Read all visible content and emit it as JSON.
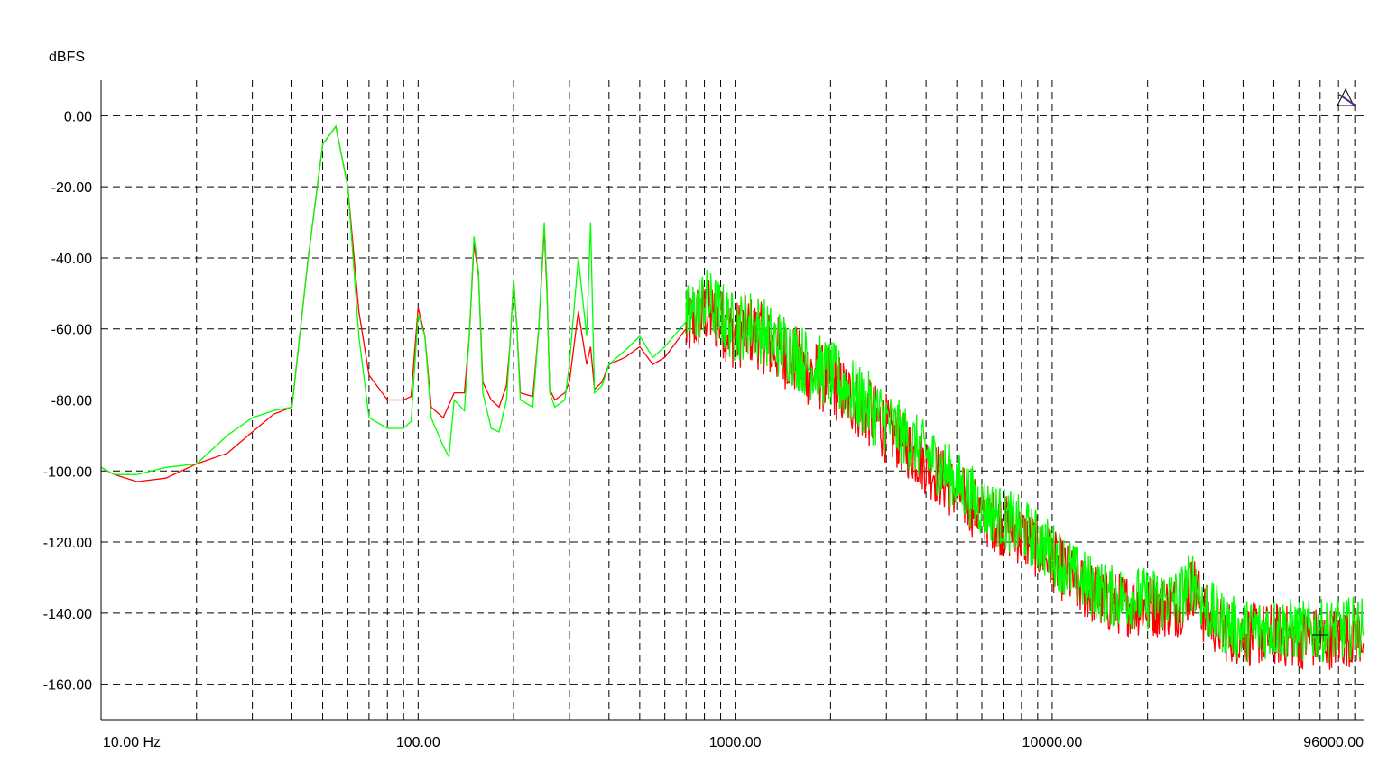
{
  "chart_data": {
    "type": "line",
    "title": "",
    "ylabel": "dBFS",
    "xlabel": "",
    "x_scale": "log",
    "xlim": [
      10,
      96000
    ],
    "ylim": [
      -170,
      10
    ],
    "grid": true,
    "x_tick_labels": [
      {
        "value": 10,
        "label": "10.00 Hz"
      },
      {
        "value": 100,
        "label": "100.00"
      },
      {
        "value": 1000,
        "label": "1000.00"
      },
      {
        "value": 10000,
        "label": "10000.00"
      },
      {
        "value": 96000,
        "label": "96000.00"
      }
    ],
    "y_tick_labels": [
      {
        "value": 0,
        "label": "0.00"
      },
      {
        "value": -20,
        "label": "-20.00"
      },
      {
        "value": -40,
        "label": "-40.00"
      },
      {
        "value": -60,
        "label": "-60.00"
      },
      {
        "value": -80,
        "label": "-80.00"
      },
      {
        "value": -100,
        "label": "-100.00"
      },
      {
        "value": -120,
        "label": "-120.00"
      },
      {
        "value": -140,
        "label": "-140.00"
      },
      {
        "value": -160,
        "label": "-160.00"
      }
    ],
    "series": [
      {
        "color": "#ff0000",
        "x": [
          10,
          11,
          13,
          16,
          20,
          25,
          30,
          35,
          40,
          45,
          50,
          55,
          60,
          65,
          70,
          80,
          90,
          95,
          100,
          105,
          110,
          120,
          130,
          140,
          145,
          150,
          155,
          160,
          170,
          180,
          190,
          195,
          200,
          205,
          210,
          230,
          240,
          250,
          255,
          260,
          270,
          290,
          300,
          320,
          340,
          350,
          360,
          380,
          400,
          450,
          500,
          550,
          600,
          700,
          800,
          900,
          1000,
          1100,
          1200,
          1300,
          1500,
          1700,
          2000,
          2500,
          3000,
          4000,
          5000,
          6000,
          8000,
          10000,
          12000,
          15000,
          20000,
          25000,
          28000,
          30000,
          35000,
          40000,
          50000,
          60000,
          80000,
          90000,
          96000
        ],
        "values": [
          -99,
          -101,
          -103,
          -102,
          -98,
          -95,
          -89,
          -84,
          -82,
          -40,
          -8,
          -3,
          -20,
          -55,
          -73,
          -80,
          -80,
          -79,
          -54,
          -62,
          -82,
          -85,
          -78,
          -78,
          -62,
          -36,
          -45,
          -75,
          -80,
          -82,
          -76,
          -64,
          -46,
          -60,
          -78,
          -79,
          -60,
          -32,
          -50,
          -77,
          -80,
          -78,
          -75,
          -55,
          -70,
          -65,
          -77,
          -75,
          -70,
          -68,
          -65,
          -70,
          -68,
          -60,
          -55,
          -58,
          -62,
          -60,
          -62,
          -65,
          -68,
          -72,
          -75,
          -82,
          -88,
          -98,
          -106,
          -112,
          -118,
          -125,
          -132,
          -137,
          -138,
          -138,
          -132,
          -140,
          -145,
          -146,
          -146,
          -147,
          -147,
          -146,
          -146
        ]
      },
      {
        "color": "#00ff00",
        "x": [
          10,
          11,
          13,
          16,
          20,
          25,
          30,
          35,
          40,
          45,
          50,
          55,
          60,
          65,
          70,
          80,
          90,
          95,
          100,
          105,
          110,
          120,
          125,
          130,
          140,
          145,
          150,
          155,
          160,
          170,
          180,
          190,
          195,
          200,
          205,
          210,
          230,
          240,
          250,
          255,
          260,
          270,
          290,
          300,
          320,
          340,
          350,
          360,
          380,
          400,
          450,
          500,
          550,
          600,
          700,
          800,
          900,
          1000,
          1100,
          1200,
          1300,
          1500,
          1700,
          2000,
          2500,
          3000,
          4000,
          5000,
          6000,
          8000,
          10000,
          12000,
          15000,
          20000,
          25000,
          28000,
          30000,
          35000,
          40000,
          50000,
          60000,
          80000,
          90000,
          96000
        ],
        "values": [
          -99,
          -101,
          -101,
          -99,
          -98,
          -90,
          -85,
          -83,
          -82,
          -40,
          -8,
          -3,
          -20,
          -62,
          -85,
          -88,
          -88,
          -86,
          -56,
          -62,
          -85,
          -93,
          -96,
          -80,
          -83,
          -62,
          -34,
          -44,
          -78,
          -88,
          -89,
          -80,
          -64,
          -46,
          -60,
          -80,
          -82,
          -60,
          -30,
          -48,
          -78,
          -82,
          -80,
          -70,
          -40,
          -62,
          -30,
          -78,
          -76,
          -70,
          -66,
          -62,
          -68,
          -65,
          -58,
          -52,
          -56,
          -60,
          -58,
          -60,
          -63,
          -66,
          -70,
          -73,
          -80,
          -86,
          -95,
          -103,
          -110,
          -116,
          -123,
          -130,
          -135,
          -136,
          -136,
          -130,
          -138,
          -143,
          -145,
          -144,
          -145,
          -145,
          -144,
          -144
        ]
      }
    ]
  }
}
